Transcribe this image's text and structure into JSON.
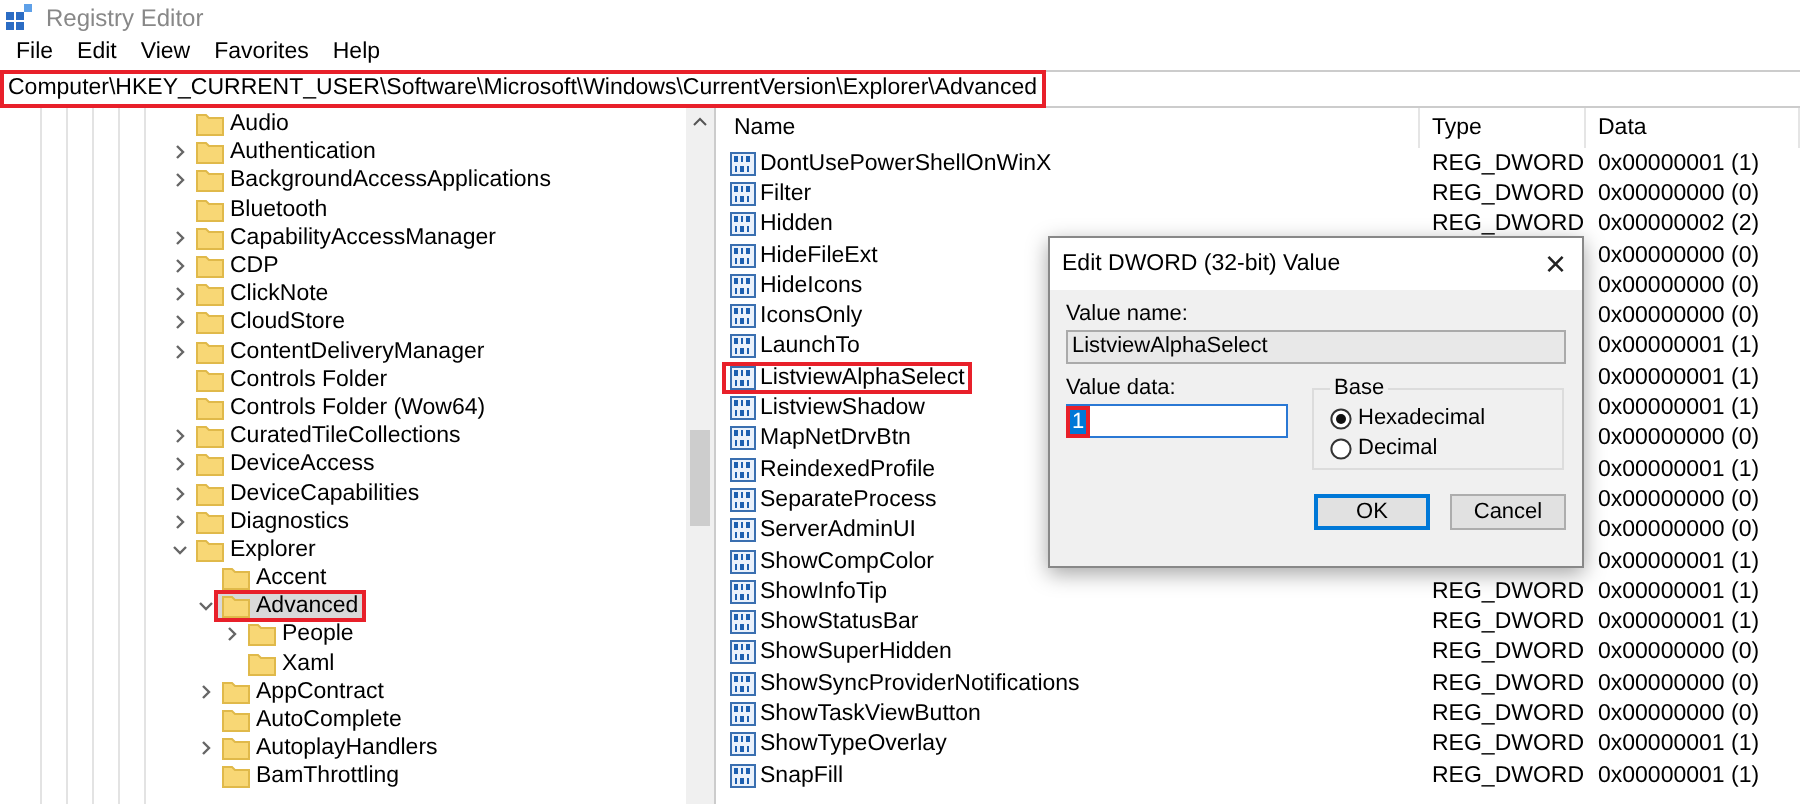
{
  "window": {
    "title": "Registry Editor"
  },
  "menu": [
    "File",
    "Edit",
    "View",
    "Favorites",
    "Help"
  ],
  "address": {
    "value": "Computer\\HKEY_CURRENT_USER\\Software\\Microsoft\\Windows\\CurrentVersion\\Explorer\\Advanced",
    "marked": true
  },
  "tree": [
    {
      "label": "Audio",
      "expandable": false,
      "selected": false,
      "marked": false
    },
    {
      "label": "Authentication",
      "expandable": true,
      "expanded": false,
      "selected": false,
      "marked": false
    },
    {
      "label": "BackgroundAccessApplications",
      "expandable": true,
      "expanded": false,
      "selected": false,
      "marked": false
    },
    {
      "label": "Bluetooth",
      "expandable": false,
      "selected": false,
      "marked": false
    },
    {
      "label": "CapabilityAccessManager",
      "expandable": true,
      "expanded": false,
      "selected": false,
      "marked": false
    },
    {
      "label": "CDP",
      "expandable": true,
      "expanded": false,
      "selected": false,
      "marked": false
    },
    {
      "label": "ClickNote",
      "expandable": true,
      "expanded": false,
      "selected": false,
      "marked": false
    },
    {
      "label": "CloudStore",
      "expandable": true,
      "expanded": false,
      "selected": false,
      "marked": false
    },
    {
      "label": "ContentDeliveryManager",
      "expandable": true,
      "expanded": false,
      "selected": false,
      "marked": false
    },
    {
      "label": "Controls Folder",
      "expandable": false,
      "selected": false,
      "marked": false
    },
    {
      "label": "Controls Folder (Wow64)",
      "expandable": false,
      "selected": false,
      "marked": false
    },
    {
      "label": "CuratedTileCollections",
      "expandable": true,
      "expanded": false,
      "selected": false,
      "marked": false
    },
    {
      "label": "DeviceAccess",
      "expandable": true,
      "expanded": false,
      "selected": false,
      "marked": false
    },
    {
      "label": "DeviceCapabilities",
      "expandable": true,
      "expanded": false,
      "selected": false,
      "marked": false
    },
    {
      "label": "Diagnostics",
      "expandable": true,
      "expanded": false,
      "selected": false,
      "marked": false
    },
    {
      "label": "Explorer",
      "expandable": true,
      "expanded": true,
      "selected": false,
      "marked": false,
      "children": [
        {
          "label": "Accent",
          "expandable": false,
          "selected": false,
          "marked": false
        },
        {
          "label": "Advanced",
          "expandable": true,
          "expanded": true,
          "selected": true,
          "marked": true,
          "children": [
            {
              "label": "People",
              "expandable": true,
              "expanded": false,
              "selected": false,
              "marked": false
            },
            {
              "label": "Xaml",
              "expandable": false,
              "selected": false,
              "marked": false
            }
          ]
        },
        {
          "label": "AppContract",
          "expandable": true,
          "expanded": false,
          "selected": false,
          "marked": false
        },
        {
          "label": "AutoComplete",
          "expandable": false,
          "selected": false,
          "marked": false
        },
        {
          "label": "AutoplayHandlers",
          "expandable": true,
          "expanded": false,
          "selected": false,
          "marked": false
        },
        {
          "label": "BamThrottling",
          "expandable": false,
          "selected": false,
          "marked": false
        }
      ]
    }
  ],
  "columns": [
    "Name",
    "Type",
    "Data"
  ],
  "values": [
    {
      "name": "DontUsePowerShellOnWinX",
      "type": "REG_DWORD",
      "data": "0x00000001 (1)",
      "marked": false
    },
    {
      "name": "Filter",
      "type": "REG_DWORD",
      "data": "0x00000000 (0)",
      "marked": false
    },
    {
      "name": "Hidden",
      "type": "REG_DWORD",
      "data": "0x00000002 (2)",
      "marked": false
    },
    {
      "name": "HideFileExt",
      "data": "0x00000000 (0)",
      "marked": false
    },
    {
      "name": "HideIcons",
      "data": "0x00000000 (0)",
      "marked": false
    },
    {
      "name": "IconsOnly",
      "data": "0x00000000 (0)",
      "marked": false
    },
    {
      "name": "LaunchTo",
      "data": "0x00000001 (1)",
      "marked": false
    },
    {
      "name": "ListviewAlphaSelect",
      "data": "0x00000001 (1)",
      "marked": true
    },
    {
      "name": "ListviewShadow",
      "data": "0x00000001 (1)",
      "marked": false
    },
    {
      "name": "MapNetDrvBtn",
      "data": "0x00000000 (0)",
      "marked": false
    },
    {
      "name": "ReindexedProfile",
      "data": "0x00000001 (1)",
      "marked": false
    },
    {
      "name": "SeparateProcess",
      "data": "0x00000000 (0)",
      "marked": false
    },
    {
      "name": "ServerAdminUI",
      "data": "0x00000000 (0)",
      "marked": false
    },
    {
      "name": "ShowCompColor",
      "data": "0x00000001 (1)",
      "marked": false
    },
    {
      "name": "ShowInfoTip",
      "type": "REG_DWORD",
      "data": "0x00000001 (1)",
      "marked": false
    },
    {
      "name": "ShowStatusBar",
      "type": "REG_DWORD",
      "data": "0x00000001 (1)",
      "marked": false
    },
    {
      "name": "ShowSuperHidden",
      "type": "REG_DWORD",
      "data": "0x00000000 (0)",
      "marked": false
    },
    {
      "name": "ShowSyncProviderNotifications",
      "type": "REG_DWORD",
      "data": "0x00000000 (0)",
      "marked": false
    },
    {
      "name": "ShowTaskViewButton",
      "type": "REG_DWORD",
      "data": "0x00000000 (0)",
      "marked": false
    },
    {
      "name": "ShowTypeOverlay",
      "type": "REG_DWORD",
      "data": "0x00000001 (1)",
      "marked": false
    },
    {
      "name": "SnapFill",
      "type": "REG_DWORD",
      "data": "0x00000001 (1)",
      "marked": false
    }
  ],
  "dialog": {
    "title": "Edit DWORD (32-bit) Value",
    "close": "×",
    "value_name_label": "Value name:",
    "value_name": "ListviewAlphaSelect",
    "value_data_label": "Value data:",
    "value_data": "1",
    "value_data_marked": true,
    "base_label": "Base",
    "bases": [
      {
        "label": "Hexadecimal",
        "selected": true
      },
      {
        "label": "Decimal",
        "selected": false
      }
    ],
    "buttons": [
      {
        "label": "OK",
        "kind": "default"
      },
      {
        "label": "Cancel",
        "kind": "normal"
      }
    ]
  }
}
